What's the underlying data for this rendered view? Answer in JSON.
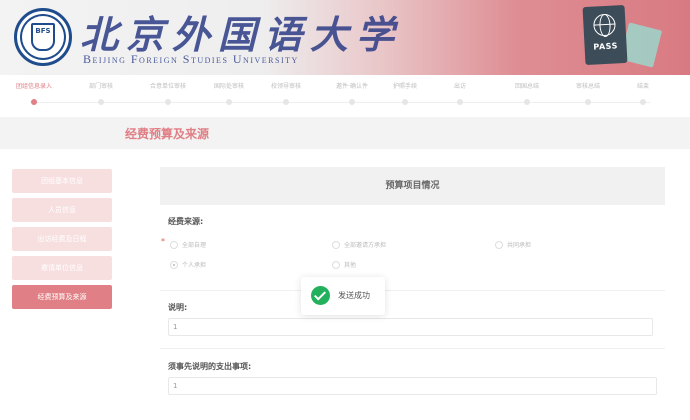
{
  "header": {
    "logo_cn": "北京外国语大学",
    "logo_en": "Beijing Foreign Studies University",
    "seal_text": "BFS",
    "passport_label": "PASS"
  },
  "steps": [
    {
      "label": "团组信息录入",
      "active": true
    },
    {
      "label": "部门审核",
      "active": false
    },
    {
      "label": "合意单位审核",
      "active": false
    },
    {
      "label": "国际处审核",
      "active": false
    },
    {
      "label": "校领导审核",
      "active": false
    },
    {
      "label": "邀件·确认件",
      "active": false
    },
    {
      "label": "护照手续",
      "active": false
    },
    {
      "label": "出访",
      "active": false
    },
    {
      "label": "回国总结",
      "active": false
    },
    {
      "label": "审核总结",
      "active": false
    },
    {
      "label": "结束",
      "active": false
    }
  ],
  "section": {
    "title": "经费预算及来源"
  },
  "sidebar": {
    "items": [
      {
        "label": "团组基本信息",
        "active": false
      },
      {
        "label": "人员信息",
        "active": false
      },
      {
        "label": "出访经费及日程",
        "active": false
      },
      {
        "label": "邀请单位信息",
        "active": false
      },
      {
        "label": "经费预算及来源",
        "active": true
      }
    ]
  },
  "panel": {
    "title": "预算项目情况",
    "funding_label": "经费来源:",
    "required_mark": "*",
    "options": [
      {
        "label": "全部自理",
        "checked": false
      },
      {
        "label": "全部邀请方承担",
        "checked": false
      },
      {
        "label": "共同承担",
        "checked": false
      },
      {
        "label": "个人承担",
        "checked": true
      },
      {
        "label": "其他",
        "checked": false
      }
    ],
    "note_label": "说明:",
    "note_value": "1",
    "expense_label": "须事先说明的支出事项:",
    "expense_value": "1"
  },
  "toast": {
    "message": "发送成功"
  },
  "colors": {
    "accent": "#e07f85",
    "success": "#23b05c"
  }
}
